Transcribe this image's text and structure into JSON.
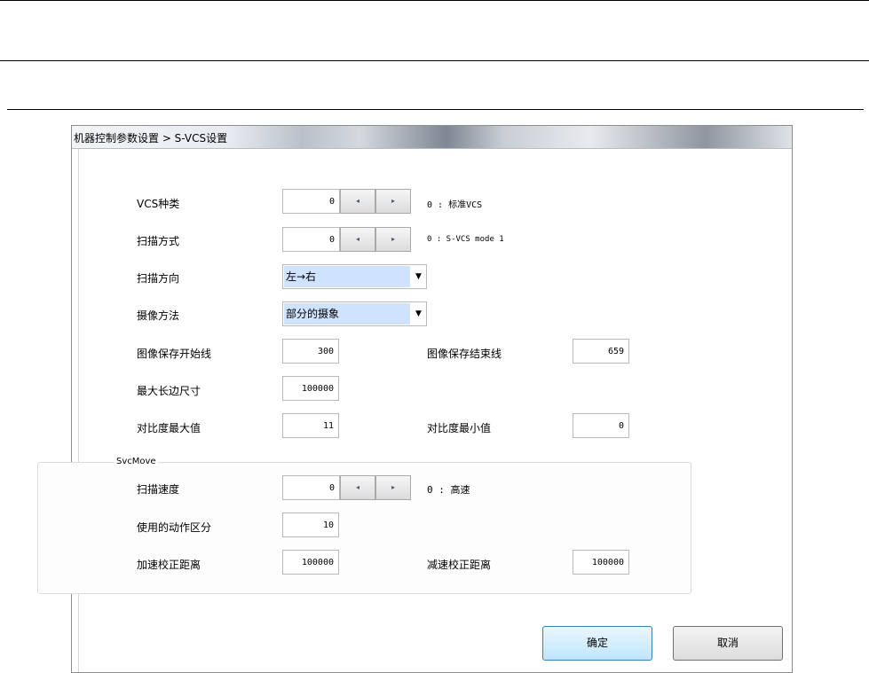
{
  "window": {
    "title": "机器控制参数设置 > S-VCS设置"
  },
  "fields": {
    "vcs_type": {
      "label": "VCS种类",
      "value": "0",
      "hint": "0 : 标准VCS"
    },
    "scan_mode": {
      "label": "扫描方式",
      "value": "0",
      "hint": "0 : S-VCS mode 1"
    },
    "scan_direction": {
      "label": "扫描方向",
      "value": "左→右"
    },
    "capture_method": {
      "label": "摄像方法",
      "value": "部分的摄象"
    },
    "image_save_start": {
      "label": "图像保存开始线",
      "value": "300"
    },
    "image_save_end": {
      "label": "图像保存结束线",
      "value": "659"
    },
    "max_long_side": {
      "label": "最大长边尺寸",
      "value": "100000"
    },
    "contrast_max": {
      "label": "对比度最大值",
      "value": "11"
    },
    "contrast_min": {
      "label": "对比度最小值",
      "value": "0"
    }
  },
  "svcmove": {
    "group_title": "SvcMove",
    "scan_speed": {
      "label": "扫描速度",
      "value": "0",
      "hint": "0 : 高速"
    },
    "motion_section": {
      "label": "使用的动作区分",
      "value": "10"
    },
    "accel_distance": {
      "label": "加速校正距离",
      "value": "100000"
    },
    "decel_distance": {
      "label": "减速校正距离",
      "value": "100000"
    }
  },
  "spinner": {
    "left_glyph": "◂",
    "right_glyph": "▸"
  },
  "dropdown_glyph": "▼",
  "buttons": {
    "ok": "确定",
    "cancel": "取消"
  }
}
